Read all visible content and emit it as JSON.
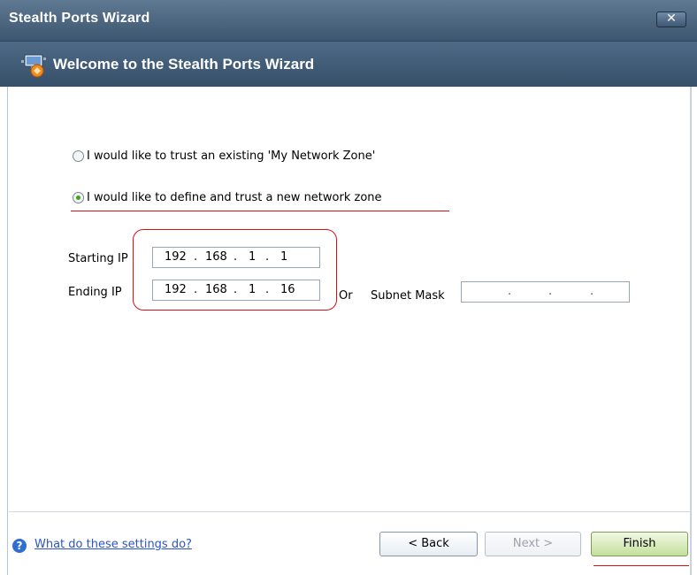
{
  "window": {
    "title": "Stealth Ports Wizard",
    "close_glyph": "✕"
  },
  "header": {
    "title": "Welcome to the Stealth Ports Wizard",
    "icon": "wizard-network-icon"
  },
  "options": [
    {
      "label": "I would like to trust an existing 'My Network Zone'",
      "checked": false
    },
    {
      "label": "I would like to define and trust a new network zone",
      "checked": true
    }
  ],
  "fields": {
    "starting_ip_label": "Starting IP",
    "starting_ip": [
      "192",
      "168",
      "1",
      "1"
    ],
    "ending_ip_label": "Ending IP",
    "ending_ip": [
      "192",
      "168",
      "1",
      "16"
    ],
    "or_label": "Or",
    "subnet_mask_label": "Subnet Mask",
    "subnet_mask": [
      "",
      "",
      "",
      ""
    ]
  },
  "footer": {
    "help_link": "What do these settings do?",
    "back": "< Back",
    "next": "Next >",
    "finish": "Finish"
  },
  "colors": {
    "annotation": "#d41111",
    "titlebar": "#4f6a86",
    "link": "#2a55c7"
  }
}
